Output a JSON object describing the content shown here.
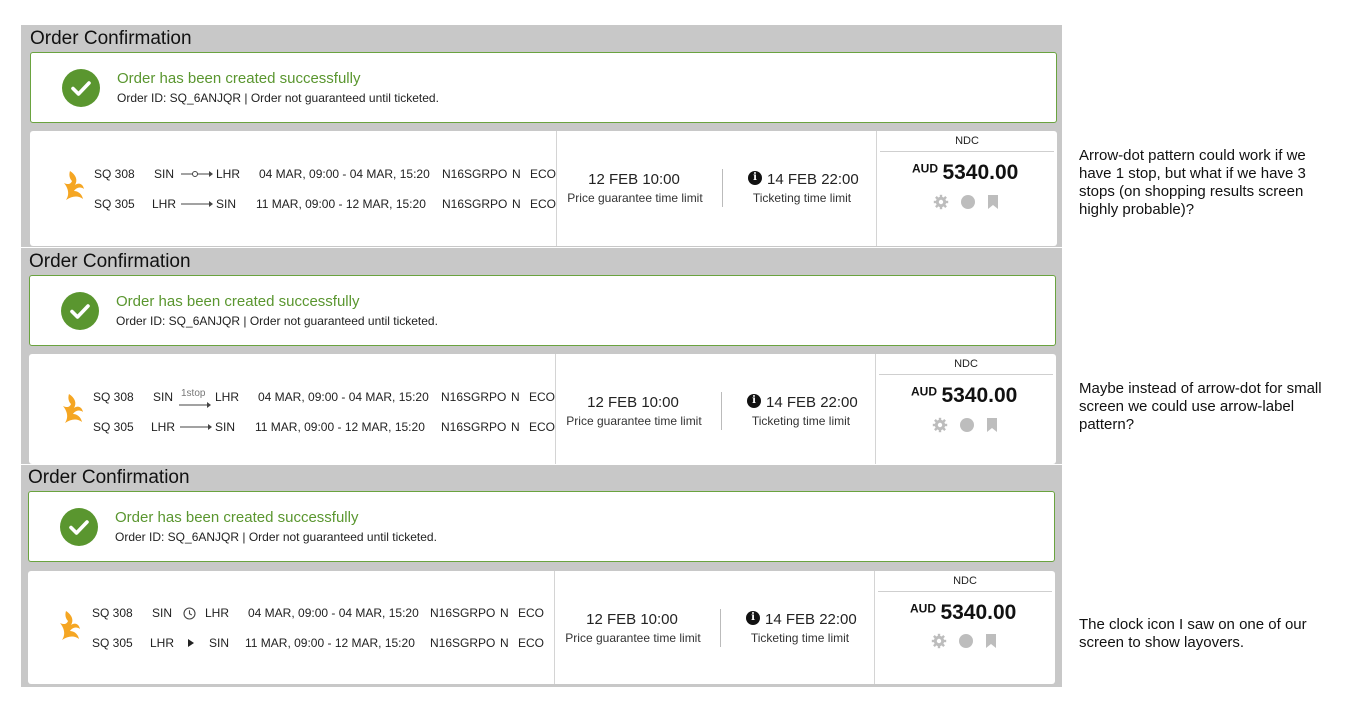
{
  "sections": [
    {
      "title": "Order Confirmation",
      "success_title": "Order has been created successfully",
      "success_sub": "Order ID: SQ_6ANJQR | Order not guaranteed until ticketed.",
      "rows": [
        {
          "flight": "SQ 308",
          "from": "SIN",
          "to": "LHR",
          "times": "04 MAR, 09:00 - 04 MAR, 15:20",
          "fare": "N16SGRPO",
          "rbd": "N",
          "cabin": "ECO"
        },
        {
          "flight": "SQ 305",
          "from": "LHR",
          "to": "SIN",
          "times": "11 MAR, 09:00 - 12 MAR, 15:20",
          "fare": "N16SGRPO",
          "rbd": "N",
          "cabin": "ECO"
        }
      ],
      "price_limit": "12 FEB 10:00",
      "price_limit_label": "Price guarantee time limit",
      "ticket_limit": "14 FEB 22:00",
      "ticket_limit_label": "Ticketing time limit",
      "ndc": "NDC",
      "currency": "AUD",
      "amount": "5340.00"
    },
    {
      "title": "Order Confirmation",
      "success_title": "Order has been created successfully",
      "success_sub": "Order ID: SQ_6ANJQR | Order not guaranteed until ticketed.",
      "stop_label": "1stop",
      "rows": [
        {
          "flight": "SQ 308",
          "from": "SIN",
          "to": "LHR",
          "times": "04 MAR, 09:00 - 04 MAR, 15:20",
          "fare": "N16SGRPO",
          "rbd": "N",
          "cabin": "ECO"
        },
        {
          "flight": "SQ 305",
          "from": "LHR",
          "to": "SIN",
          "times": "11 MAR, 09:00 - 12 MAR, 15:20",
          "fare": "N16SGRPO",
          "rbd": "N",
          "cabin": "ECO"
        }
      ],
      "price_limit": "12 FEB 10:00",
      "price_limit_label": "Price guarantee time limit",
      "ticket_limit": "14 FEB 22:00",
      "ticket_limit_label": "Ticketing time limit",
      "ndc": "NDC",
      "currency": "AUD",
      "amount": "5340.00"
    },
    {
      "title": "Order Confirmation",
      "success_title": "Order has been created successfully",
      "success_sub": "Order ID: SQ_6ANJQR | Order not guaranteed until ticketed.",
      "rows": [
        {
          "flight": "SQ 308",
          "from": "SIN",
          "to": "LHR",
          "times": "04 MAR, 09:00 - 04 MAR, 15:20",
          "fare": "N16SGRPO",
          "rbd": "N",
          "cabin": "ECO"
        },
        {
          "flight": "SQ 305",
          "from": "LHR",
          "to": "SIN",
          "times": "11 MAR, 09:00 - 12 MAR, 15:20",
          "fare": "N16SGRPO",
          "rbd": "N",
          "cabin": "ECO"
        }
      ],
      "price_limit": "12 FEB 10:00",
      "price_limit_label": "Price guarantee time limit",
      "ticket_limit": "14 FEB 22:00",
      "ticket_limit_label": "Ticketing time limit",
      "ndc": "NDC",
      "currency": "AUD",
      "amount": "5340.00"
    }
  ],
  "notes": [
    "Arrow-dot pattern could work if we have 1 stop, but what if we have 3 stops (on shopping results screen highly probable)?",
    "Maybe instead of arrow-dot for small screen we could use arrow-label pattern?",
    "The clock icon I saw on one of our screen to show layovers."
  ],
  "icons": {
    "success": "check-circle-icon",
    "airline": "singapore-airlines-logo",
    "info": "info-icon",
    "settings": "gear-icon",
    "status": "circle-icon",
    "bookmark": "bookmark-icon",
    "layover": "clock-icon"
  },
  "colors": {
    "success_green": "#5a962f",
    "panel_gray": "#c8c8c8",
    "airline_gold": "#f5a623",
    "icon_gray": "#bdbdbd"
  }
}
